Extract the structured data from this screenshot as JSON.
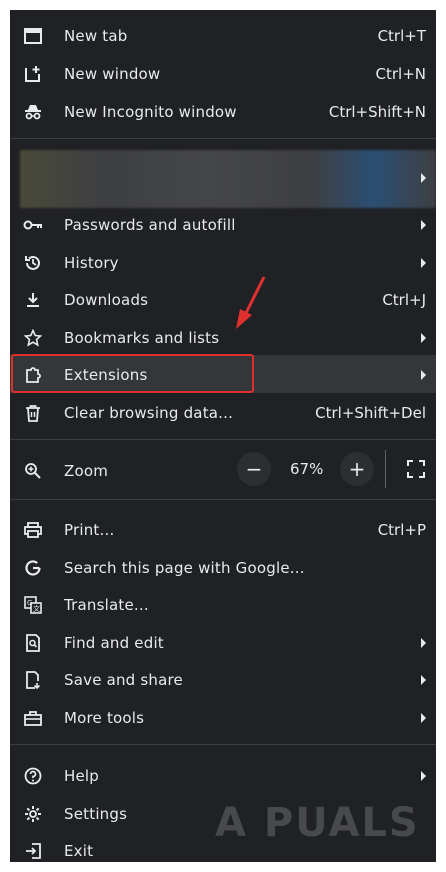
{
  "menu": {
    "new_tab": {
      "label": "New tab",
      "shortcut": "Ctrl+T"
    },
    "new_window": {
      "label": "New window",
      "shortcut": "Ctrl+N"
    },
    "new_incognito": {
      "label": "New Incognito window",
      "shortcut": "Ctrl+Shift+N"
    },
    "passwords": {
      "label": "Passwords and autofill"
    },
    "history": {
      "label": "History"
    },
    "downloads": {
      "label": "Downloads",
      "shortcut": "Ctrl+J"
    },
    "bookmarks": {
      "label": "Bookmarks and lists"
    },
    "extensions": {
      "label": "Extensions"
    },
    "clear_data": {
      "label": "Clear browsing data...",
      "shortcut": "Ctrl+Shift+Del"
    },
    "zoom": {
      "label": "Zoom",
      "value": "67%",
      "minus": "−",
      "plus": "+"
    },
    "print": {
      "label": "Print...",
      "shortcut": "Ctrl+P"
    },
    "search_page": {
      "label": "Search this page with Google..."
    },
    "translate": {
      "label": "Translate..."
    },
    "find_edit": {
      "label": "Find and edit"
    },
    "save_share": {
      "label": "Save and share"
    },
    "more_tools": {
      "label": "More tools"
    },
    "help": {
      "label": "Help"
    },
    "settings": {
      "label": "Settings"
    },
    "exit": {
      "label": "Exit"
    }
  },
  "watermark": "A PUALS",
  "colors": {
    "menu_bg": "#202124",
    "text": "#e8eaed",
    "highlight_border": "#e0302e",
    "annotation_arrow": "#e0302e"
  }
}
